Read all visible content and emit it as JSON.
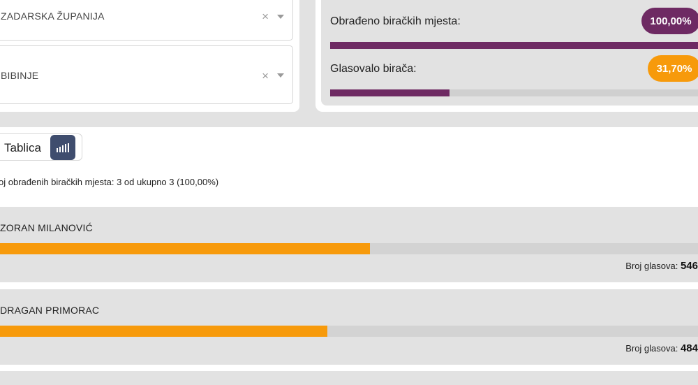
{
  "filters": {
    "county": "ZADARSKA ŽUPANIJA",
    "municipality": "BIBINJE",
    "clear_icon": "×"
  },
  "stats": {
    "processed_label": "Obrađeno biračkih mjesta:",
    "processed_value": "100,00%",
    "processed_fraction": 1.0,
    "turnout_label": "Glasovalo birača:",
    "turnout_value": "31,70%",
    "turnout_fraction": 0.317,
    "colors": {
      "purple": "#6e2a63",
      "orange": "#f79a0b"
    }
  },
  "view_toggle": {
    "table_label": "Tablica",
    "chart_icon": "bar-chart-icon"
  },
  "summary": "oj obrađenih biračkih mjesta: 3 od ukupno 3 (100,00%)",
  "candidates": [
    {
      "name": "ZORAN MILANOVIĆ",
      "votes_label": "Broj glasova:",
      "votes": "546",
      "bar_fraction": 0.53
    },
    {
      "name": "DRAGAN PRIMORAC",
      "votes_label": "Broj glasova:",
      "votes": "484",
      "bar_fraction": 0.469
    }
  ]
}
